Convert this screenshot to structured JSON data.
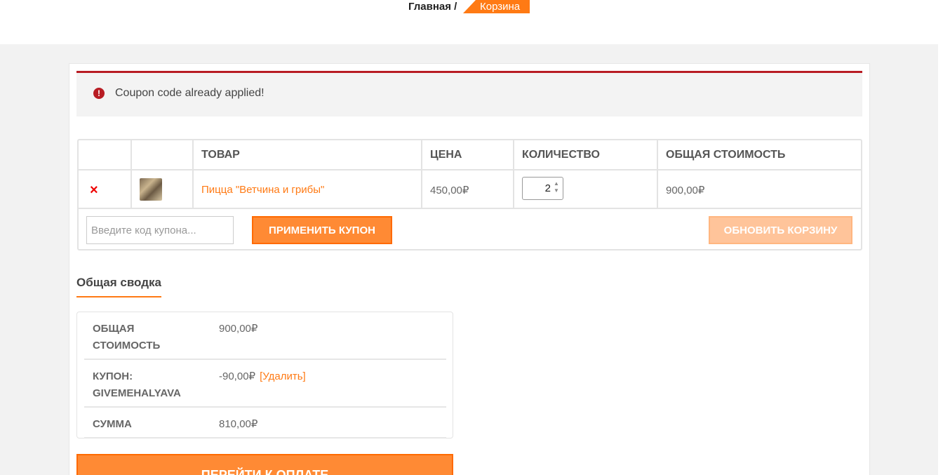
{
  "breadcrumb": {
    "home": "Главная /",
    "current": "Корзина"
  },
  "notice": {
    "icon": "error-icon",
    "text": "Coupon code already applied!",
    "color": "#b81c23"
  },
  "cart": {
    "headers": [
      "",
      "",
      "ТОВАР",
      "ЦЕНА",
      "КОЛИЧЕСТВО",
      "ОБЩАЯ СТОИМОСТЬ"
    ],
    "items": [
      {
        "remove": "×",
        "name": "Пицца \"Ветчина и грибы\"",
        "price": "450,00₽",
        "quantity": "2",
        "subtotal": "900,00₽"
      }
    ],
    "coupon_placeholder": "Введите код купона...",
    "apply_label": "Применить купон",
    "update_label": "Обновить корзину"
  },
  "totals": {
    "heading": "Общая сводка",
    "rows": [
      {
        "label_line1": "Общая",
        "label_line2": "стоимость",
        "value": "900,00₽"
      },
      {
        "label_line1": "Купон:",
        "label_line2": "givemehalyava",
        "value": "-90,00₽",
        "action": "[Удалить]"
      },
      {
        "label_line1": "Сумма",
        "label_line2": "",
        "value": "810,00₽"
      }
    ],
    "checkout_label": "Перейти к оплате"
  },
  "colors": {
    "accent": "#ff7a14",
    "error": "#b81c23",
    "remove": "#e00000"
  }
}
